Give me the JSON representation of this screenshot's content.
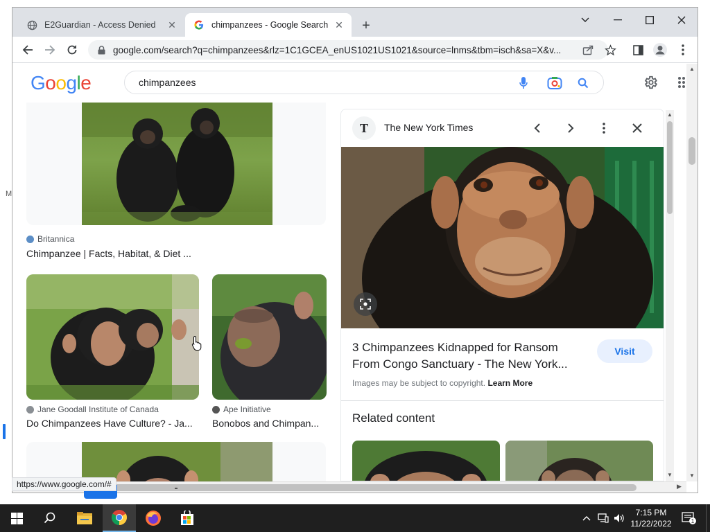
{
  "browser": {
    "tabs": [
      {
        "title": "E2Guardian - Access Denied",
        "active": false
      },
      {
        "title": "chimpanzees - Google Search",
        "active": true
      }
    ],
    "url": "google.com/search?q=chimpanzees&rlz=1C1GCEA_enUS1021US1021&source=lnms&tbm=isch&sa=X&v...",
    "status_url": "https://www.google.com/#"
  },
  "google": {
    "logo_letters": [
      "G",
      "o",
      "o",
      "g",
      "l",
      "e"
    ],
    "logo_colors": [
      "#4285F4",
      "#EA4335",
      "#FBBC05",
      "#4285F4",
      "#34A853",
      "#EA4335"
    ],
    "query": "chimpanzees"
  },
  "results": [
    {
      "source": "Britannica",
      "title": "Chimpanzee | Facts, Habitat, & Diet ..."
    },
    {
      "source": "Jane Goodall Institute of Canada",
      "title": "Do Chimpanzees Have Culture? - Ja..."
    },
    {
      "source": "Ape Initiative",
      "title": "Bonobos and Chimpan..."
    }
  ],
  "preview": {
    "source": "The New York Times",
    "source_logo": "T",
    "title": "3 Chimpanzees Kidnapped for Ransom From Congo Sanctuary - The New York...",
    "visit_label": "Visit",
    "copyright_text": "Images may be subject to copyright.",
    "learn_more": "Learn More",
    "related_heading": "Related content"
  },
  "taskbar": {
    "time": "7:15 PM",
    "date": "11/22/2022",
    "notification_count": "1"
  },
  "colors": {
    "accent": "#1a73e8",
    "tabstrip": "#dee1e6",
    "taskbar": "#1f1f1f"
  },
  "icons": [
    "globe-icon",
    "google-g-icon",
    "back-icon",
    "forward-icon",
    "reload-icon",
    "lock-icon",
    "share-icon",
    "star-icon",
    "sidebar-icon",
    "profile-icon",
    "menu-dots-icon",
    "mic-icon",
    "lens-icon",
    "search-icon",
    "gear-icon",
    "apps-grid-icon",
    "chevron-left-icon",
    "chevron-right-icon",
    "close-icon",
    "windows-start-icon",
    "search-taskbar-icon",
    "file-explorer-icon",
    "chrome-icon",
    "firefox-icon",
    "store-icon"
  ]
}
